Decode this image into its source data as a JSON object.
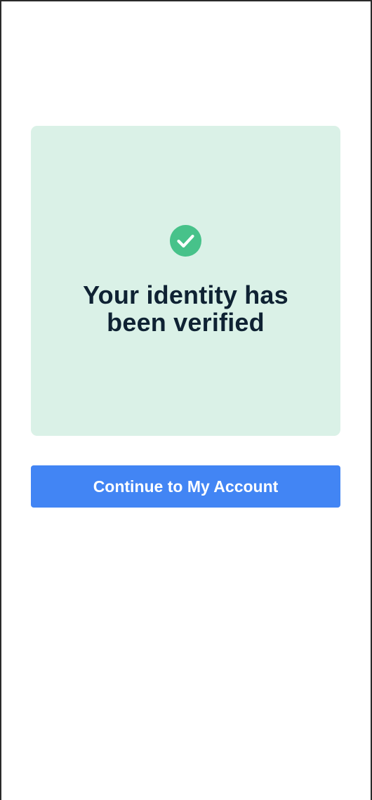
{
  "verification": {
    "status_icon": "check-circle-icon",
    "title_line1": "Your identity has",
    "title_line2": "been verified"
  },
  "actions": {
    "continue_label": "Continue to My Account"
  },
  "colors": {
    "success_background": "#daf1e7",
    "success_icon": "#47c28a",
    "title_text": "#0f2233",
    "primary_button": "#4285f4",
    "button_text": "#ffffff"
  }
}
